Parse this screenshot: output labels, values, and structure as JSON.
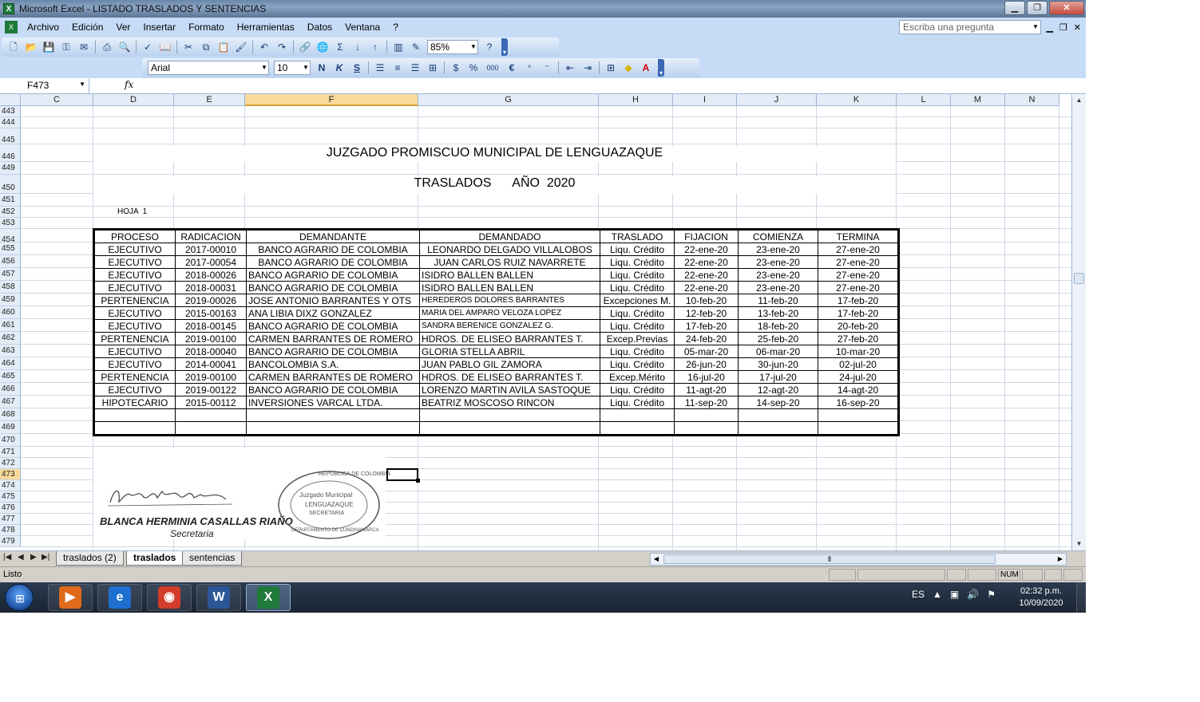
{
  "window": {
    "title": "Microsoft Excel - LISTADO TRASLADOS Y SENTENCIAS",
    "app_icon": "X"
  },
  "menu": {
    "items": [
      "Archivo",
      "Edición",
      "Ver",
      "Insertar",
      "Formato",
      "Herramientas",
      "Datos",
      "Ventana",
      "?"
    ],
    "help_placeholder": "Escriba una pregunta"
  },
  "toolbar": {
    "zoom": "85%",
    "font_name": "Arial",
    "font_size": "10",
    "bold_label": "N",
    "italic_label": "K",
    "underline_label": "S",
    "currency_label": "$",
    "percent_label": "%",
    "thousands_label": "000",
    "euro_label": "€",
    "sum_label": "Σ"
  },
  "formula_bar": {
    "name_box": "F473",
    "fx": "fx",
    "content": ""
  },
  "columns": [
    "C",
    "D",
    "E",
    "F",
    "G",
    "H",
    "I",
    "J",
    "K",
    "L",
    "M",
    "N"
  ],
  "selected_column": "F",
  "rows": [
    "443",
    "444",
    "445",
    "446",
    "449",
    "450",
    "451",
    "452",
    "453",
    "454",
    "455",
    "456",
    "457",
    "458",
    "459",
    "460",
    "461",
    "462",
    "463",
    "464",
    "465",
    "466",
    "467",
    "468",
    "469",
    "470",
    "471",
    "472",
    "473",
    "474",
    "475",
    "476",
    "477",
    "478",
    "479"
  ],
  "selected_row": "473",
  "sheet": {
    "title_court": "JUZGADO PROMISCUO MUNICIPAL DE LENGUAZAQUE",
    "title_traslados": "TRASLADOS      AÑO  2020",
    "hoja": "HOJA  1",
    "table": {
      "headers": [
        "PROCESO",
        "RADICACION",
        "DEMANDANTE",
        "DEMANDADO",
        "TRASLADO",
        "FIJACION",
        "COMIENZA",
        "TERMINA"
      ],
      "rows": [
        [
          "EJECUTIVO",
          "2017-00010",
          "BANCO AGRARIO DE COLOMBIA",
          "LEONARDO DELGADO VILLALOBOS",
          "Liqu. Crédito",
          "22-ene-20",
          "23-ene-20",
          "27-ene-20"
        ],
        [
          "EJECUTIVO",
          "2017-00054",
          "BANCO AGRARIO DE COLOMBIA",
          "JUAN CARLOS RUIZ NAVARRETE",
          "Liqu. Crédito",
          "22-ene-20",
          "23-ene-20",
          "27-ene-20"
        ],
        [
          "EJECUTIVO",
          "2018-00026",
          "BANCO AGRARIO DE COLOMBIA",
          "ISIDRO BALLEN BALLEN",
          "Liqu. Crédito",
          "22-ene-20",
          "23-ene-20",
          "27-ene-20"
        ],
        [
          "EJECUTIVO",
          "2018-00031",
          "BANCO AGRARIO DE COLOMBIA",
          "ISIDRO BALLEN BALLEN",
          "Liqu. Crédito",
          "22-ene-20",
          "23-ene-20",
          "27-ene-20"
        ],
        [
          "PERTENENCIA",
          "2019-00026",
          "JOSE ANTONIO BARRANTES Y OTS",
          "HEREDEROS DOLORES BARRANTES",
          "Excepciones M.",
          "10-feb-20",
          "11-feb-20",
          "17-feb-20"
        ],
        [
          "EJECUTIVO",
          "2015-00163",
          "ANA LIBIA DIXZ GONZALEZ",
          "MARIA DEL AMPARO VELOZA LOPEZ",
          "Liqu. Crédito",
          "12-feb-20",
          "13-feb-20",
          "17-feb-20"
        ],
        [
          "EJECUTIVO",
          "2018-00145",
          "BANCO AGRARIO DE COLOMBIA",
          "SANDRA BERENICE GONZALEZ G.",
          "Liqu. Crédito",
          "17-feb-20",
          "18-feb-20",
          "20-feb-20"
        ],
        [
          "PERTENENCIA",
          "2019-00100",
          "CARMEN BARRANTES DE ROMERO",
          "HDROS. DE ELISEO BARRANTES T.",
          "Excep.Previas",
          "24-feb-20",
          "25-feb-20",
          "27-feb-20"
        ],
        [
          "EJECUTIVO",
          "2018-00040",
          "BANCO AGRARIO DE COLOMBIA",
          "GLORIA STELLA ABRIL",
          "Liqu. Crédito",
          "05-mar-20",
          "06-mar-20",
          "10-mar-20"
        ],
        [
          "EJECUTIVO",
          "2014-00041",
          "BANCOLOMBIA S.A.",
          "JUAN PABLO GIL ZAMORA",
          "Liqu. Crédito",
          "26-jun-20",
          "30-jun-20",
          "02-jul-20"
        ],
        [
          "PERTENENCIA",
          "2019-00100",
          "CARMEN BARRANTES DE ROMERO",
          "HDROS. DE ELISEO BARRANTES T.",
          "Excep.Mérito",
          "16-jul-20",
          "17-jul-20",
          "24-jul-20"
        ],
        [
          "EJECUTIVO",
          "2019-00122",
          "BANCO AGRARIO DE COLOMBIA",
          "LORENZO MARTIN AVILA SASTOQUE",
          "Liqu. Crédito",
          "11-agt-20",
          "12-agt-20",
          "14-agt-20"
        ],
        [
          "HIPOTECARIO",
          "2015-00112",
          "INVERSIONES VARCAL LTDA.",
          "BEATRIZ MOSCOSO RINCON",
          "Liqu. Crédito",
          "11-sep-20",
          "14-sep-20",
          "16-sep-20"
        ],
        [
          "",
          "",
          "",
          "",
          "",
          "",
          "",
          ""
        ],
        [
          "",
          "",
          "",
          "",
          "",
          "",
          "",
          ""
        ]
      ]
    },
    "signature": {
      "name": "BLANCA HERMINIA CASALLAS RIAÑO",
      "role": "Secretaria",
      "seal_lines": [
        "REPUBLICA DE COLOMBIA",
        "Juzgado Municipal",
        "LENGUAZAQUE",
        "SECRETARIA",
        "DEPARTAMENTO DE CUNDINAMARCA"
      ]
    }
  },
  "sheet_tabs": [
    {
      "label": "traslados (2)",
      "active": false
    },
    {
      "label": "traslados",
      "active": true
    },
    {
      "label": "sentencias",
      "active": false
    }
  ],
  "status": {
    "text": "Listo",
    "num": "NUM"
  },
  "taskbar": {
    "apps": [
      {
        "name": "media-player",
        "label": "▶",
        "color": "#e06a1a"
      },
      {
        "name": "internet-explorer",
        "label": "e",
        "color": "#1e6fd0"
      },
      {
        "name": "chrome",
        "label": "◉",
        "color": "#d23c2a"
      },
      {
        "name": "word",
        "label": "W",
        "color": "#2b5797"
      },
      {
        "name": "excel",
        "label": "X",
        "color": "#1f7a3a"
      }
    ],
    "language": "ES",
    "time": "02:32 p.m.",
    "date": "10/09/2020"
  }
}
